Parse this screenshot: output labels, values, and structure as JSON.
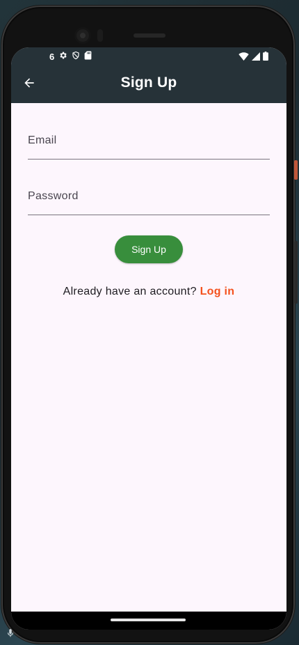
{
  "status_bar": {
    "time": "6",
    "left_icons": [
      "settings-icon",
      "shield-icon",
      "sd-card-icon"
    ],
    "right_icons": [
      "wifi-icon",
      "cell-signal-icon",
      "battery-icon"
    ]
  },
  "app_bar": {
    "title": "Sign Up",
    "back_icon": "arrow-back-icon"
  },
  "form": {
    "email": {
      "placeholder": "Email",
      "value": ""
    },
    "password": {
      "placeholder": "Password",
      "value": ""
    },
    "submit_label": "Sign Up"
  },
  "footer": {
    "prompt": "Already have an account?",
    "link_label": "Log in"
  },
  "colors": {
    "app_bar": "#263238",
    "background": "#fdf6fd",
    "button": "#388e3c",
    "link": "#f4511e"
  }
}
